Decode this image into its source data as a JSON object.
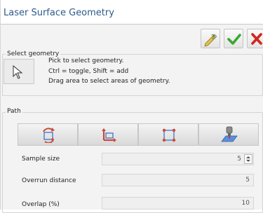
{
  "title": "Laser Surface Geometry",
  "toolbar": [
    {
      "name": "help-button",
      "icon": "help-pencil-icon"
    },
    {
      "name": "ok-button",
      "icon": "green-check-icon"
    },
    {
      "name": "cancel-button",
      "icon": "red-x-icon"
    }
  ],
  "select_geometry": {
    "label": "Select geometry",
    "pick_icon": "cursor-arrow-icon",
    "instructions": [
      "Pick to select geometry.",
      "Ctrl = toggle, Shift = add",
      "Drag area to select areas of geometry."
    ]
  },
  "path": {
    "label": "Path",
    "tools": [
      {
        "name": "rotate-path-icon"
      },
      {
        "name": "axis-path-icon"
      },
      {
        "name": "fit-frame-icon"
      },
      {
        "name": "laser-probe-icon"
      }
    ]
  },
  "fields": [
    {
      "label": "Sample size",
      "value": "5",
      "spinner": true
    },
    {
      "label": "Overrun distance",
      "value": "5",
      "spinner": false
    },
    {
      "label": "Overlap (%)",
      "value": "10",
      "spinner": false
    }
  ],
  "colors": {
    "title": "#2d5a8a",
    "check": "#3aa82c",
    "cancel": "#d0271d",
    "tool_red": "#c94a3a",
    "tool_blue": "#3e74c4"
  }
}
